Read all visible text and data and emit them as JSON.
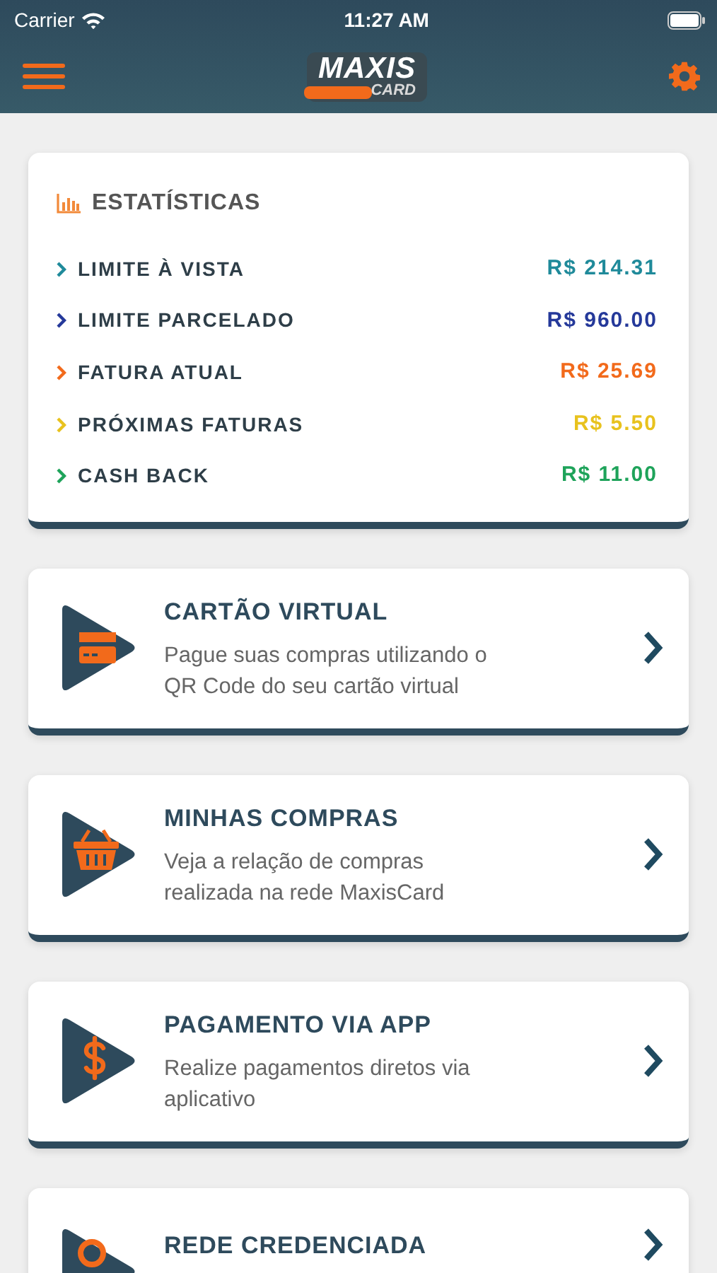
{
  "status_bar": {
    "carrier": "Carrier",
    "time": "11:27 AM"
  },
  "header": {
    "logo_top": "MAXIS",
    "logo_bottom": "CARD"
  },
  "statistics": {
    "title": "ESTATÍSTICAS",
    "rows": [
      {
        "label": "LIMITE À VISTA",
        "value": "R$ 214.31",
        "color": "#1f8a9a"
      },
      {
        "label": "LIMITE PARCELADO",
        "value": "R$ 960.00",
        "color": "#25399a"
      },
      {
        "label": "FATURA ATUAL",
        "value": "R$ 25.69",
        "color": "#f26a1b"
      },
      {
        "label": "PRÓXIMAS FATURAS",
        "value": "R$ 5.50",
        "color": "#e8c21e"
      },
      {
        "label": "CASH BACK",
        "value": "R$ 11.00",
        "color": "#1ea35a"
      }
    ]
  },
  "menu": [
    {
      "kind": "card",
      "title": "CARTÃO VIRTUAL",
      "description": "Pague suas compras utilizando o QR Code do seu cartão virtual"
    },
    {
      "kind": "basket",
      "title": "MINHAS COMPRAS",
      "description": "Veja a relação de compras realizada na rede MaxisCard"
    },
    {
      "kind": "dollar",
      "title": "PAGAMENTO VIA APP",
      "description": "Realize pagamentos diretos via aplicativo"
    },
    {
      "kind": "pin",
      "title": "REDE CREDENCIADA"
    }
  ]
}
